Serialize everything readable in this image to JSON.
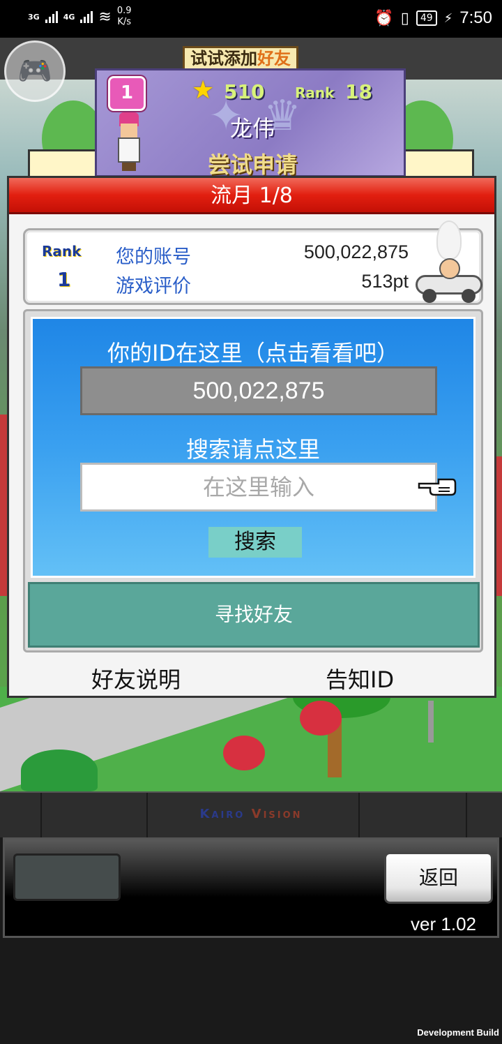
{
  "status_bar": {
    "signal1": "3G",
    "signal2": "4G",
    "net_speed": "0.9",
    "net_speed_unit": "K/s",
    "battery": "49",
    "time": "7:50",
    "icons": [
      "alarm-icon",
      "vibrate-icon",
      "wifi-icon",
      "battery-icon",
      "charging-icon"
    ]
  },
  "overlay": {
    "gamepad_icon": "gamepad-icon"
  },
  "banner": {
    "tag_prefix": "试试添加",
    "tag_highlight": "好友",
    "level": "1",
    "stars": "510",
    "rank_label": "Rank",
    "rank": "18",
    "player_name": "龙伟",
    "status": "尝试申请"
  },
  "panel": {
    "header": "流月 1/8",
    "rank_label": "Rank",
    "rank_value": "1",
    "account_label": "您的账号",
    "account_value": "500,022,875",
    "evaluation_label": "游戏评价",
    "evaluation_value": "513pt",
    "id_title": "你的ID在这里（点击看看吧）",
    "id_value": "500,022,875",
    "search_label": "搜索请点这里",
    "search_input": {
      "value": "",
      "placeholder": "在这里输入"
    },
    "search_button": "搜索",
    "find_button": "寻找好友",
    "friend_help": "好友说明",
    "tell_id": "告知ID"
  },
  "brand": {
    "logo_k": "Kairo",
    "logo_v": "Vision"
  },
  "controls": {
    "back_button": "返回",
    "version": "ver 1.02"
  },
  "footer": {
    "dev_build": "Development Build"
  },
  "colors": {
    "header_red": "#e21f10",
    "panel_blue": "#3aa0f0",
    "find_button_teal": "#5aa79a",
    "search_button_teal": "#79cfc8",
    "label_blue": "#2a5ec8"
  }
}
